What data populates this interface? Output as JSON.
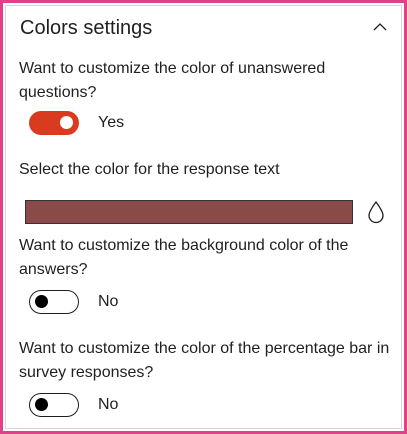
{
  "panel": {
    "title": "Colors settings",
    "collapse_icon": "chevron-up-icon"
  },
  "unanswered": {
    "label": "Want to customize the color of unanswered questions?",
    "toggle_state": true,
    "toggle_text": "Yes"
  },
  "response_text": {
    "label": "Select the color for the response text",
    "swatch_color": "#8b4a4a",
    "picker_icon": "droplet-icon"
  },
  "background": {
    "label": "Want to customize the background color of the answers?",
    "toggle_state": false,
    "toggle_text": "No"
  },
  "percentage_bar": {
    "label": "Want to customize the color of the percentage bar in survey responses?",
    "toggle_state": false,
    "toggle_text": "No"
  },
  "colors": {
    "frame": "#e0428a",
    "toggle_on": "#d83b1e"
  }
}
